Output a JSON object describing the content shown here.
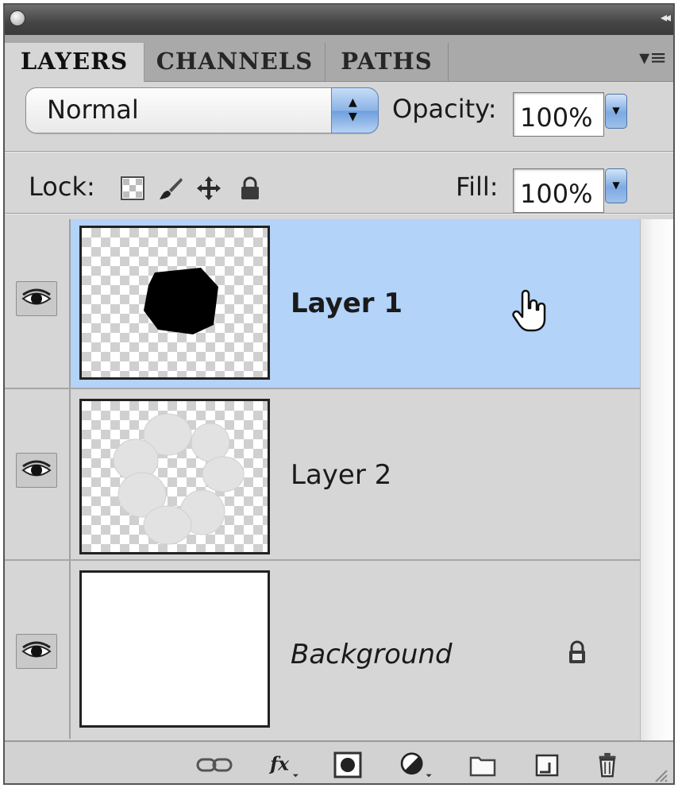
{
  "tabs": [
    {
      "label": "LAYERS",
      "active": true
    },
    {
      "label": "CHANNELS",
      "active": false
    },
    {
      "label": "PATHS",
      "active": false
    }
  ],
  "blend_mode": {
    "value": "Normal"
  },
  "opacity": {
    "label": "Opacity:",
    "value": "100%"
  },
  "lock": {
    "label": "Lock:",
    "icons": [
      "lock-transparent-pixels-icon",
      "lock-image-pixels-icon",
      "lock-position-icon",
      "lock-all-icon"
    ]
  },
  "fill": {
    "label": "Fill:",
    "value": "100%"
  },
  "layers": [
    {
      "name": "Layer 1",
      "selected": true,
      "visible": true
    },
    {
      "name": "Layer 2",
      "selected": false,
      "visible": true
    },
    {
      "name": "Background",
      "selected": false,
      "visible": true,
      "locked": true
    }
  ],
  "bottom_icons": [
    "link-layers-icon",
    "fx-icon",
    "layer-mask-icon",
    "adjustment-layer-icon",
    "new-group-icon",
    "new-layer-icon",
    "trash-icon"
  ],
  "colors": {
    "panel_bg": "#d6d6d6",
    "selected_row": "#b3d3f8",
    "tab_bar": "#a9a9a9",
    "title_bar": "#444444"
  }
}
